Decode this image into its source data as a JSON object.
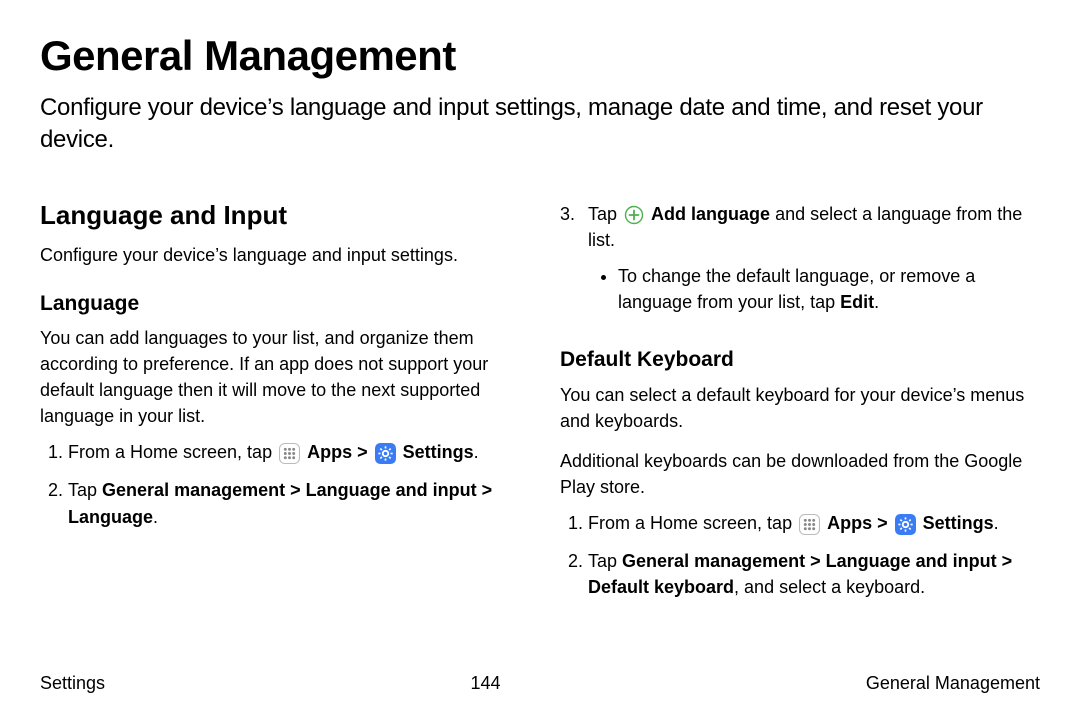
{
  "title": "General Management",
  "intro": "Configure your device’s language and input settings, manage date and time, and reset your device.",
  "section_heading": "Language and Input",
  "section_desc": "Configure your device’s language and input settings.",
  "sub1_heading": "Language",
  "sub1_desc": "You can add languages to your list, and organize them according to preference. If an app does not support your default language then it will move to the next supported language in your list.",
  "step_from_home_prefix": "From a Home screen, tap ",
  "apps_label": "Apps",
  "angle": ">",
  "settings_label": "Settings",
  "period": ".",
  "s1_step2_prefix": "Tap ",
  "s1_step2_bold": "General management > Language and input > Language",
  "s1_step3_num": "3.",
  "s1_step3_prefix": "Tap ",
  "s1_step3_bold": "Add language",
  "s1_step3_suffix": " and select a language from the list.",
  "s1_bullet_prefix": "To change the default language, or remove a language from your list, tap ",
  "s1_bullet_bold": "Edit",
  "sub2_heading": "Default Keyboard",
  "sub2_desc1": "You can select a default keyboard for your device’s menus and keyboards.",
  "sub2_desc2": "Additional keyboards can be downloaded from the Google Play store.",
  "s2_step2_prefix": "Tap ",
  "s2_step2_bold": "General management > Language and input > Default keyboard",
  "s2_step2_suffix": ", and select a keyboard.",
  "footer_left": "Settings",
  "footer_center": "144",
  "footer_right": "General Management"
}
